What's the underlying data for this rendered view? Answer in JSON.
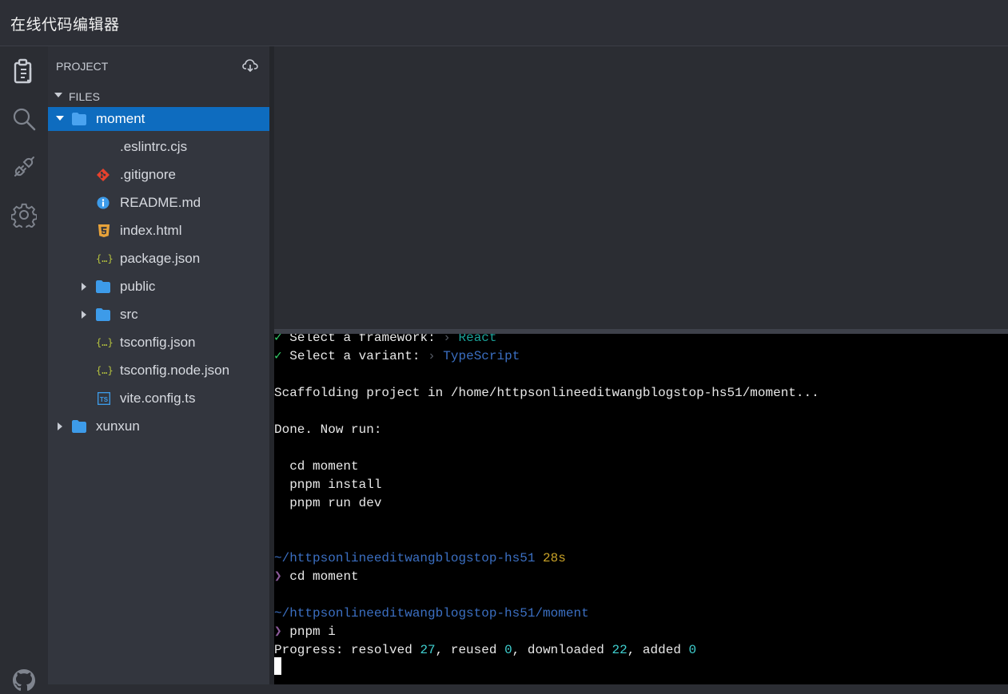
{
  "app": {
    "title": "在线代码编辑器"
  },
  "activity_bar": {
    "icons": [
      "explorer-icon",
      "search-icon",
      "plug-icon",
      "gear-icon",
      "github-icon"
    ]
  },
  "sidebar": {
    "header": "PROJECT",
    "header_icon": "cloud-download-icon",
    "section": "FILES",
    "tree": [
      {
        "name": "moment",
        "type": "folder",
        "expanded": true,
        "depth": 0,
        "selected": true
      },
      {
        "name": ".eslintrc.cjs",
        "type": "file",
        "icon": "none",
        "depth": 1
      },
      {
        "name": ".gitignore",
        "type": "file",
        "icon": "git-icon",
        "depth": 1
      },
      {
        "name": "README.md",
        "type": "file",
        "icon": "info-icon",
        "depth": 1
      },
      {
        "name": "index.html",
        "type": "file",
        "icon": "html5-icon",
        "depth": 1
      },
      {
        "name": "package.json",
        "type": "file",
        "icon": "json-icon",
        "depth": 1
      },
      {
        "name": "public",
        "type": "folder",
        "expanded": false,
        "depth": 1
      },
      {
        "name": "src",
        "type": "folder",
        "expanded": false,
        "depth": 1
      },
      {
        "name": "tsconfig.json",
        "type": "file",
        "icon": "json-icon",
        "depth": 1
      },
      {
        "name": "tsconfig.node.json",
        "type": "file",
        "icon": "json-icon",
        "depth": 1
      },
      {
        "name": "vite.config.ts",
        "type": "file",
        "icon": "typescript-icon",
        "depth": 1
      },
      {
        "name": "xunxun",
        "type": "folder",
        "expanded": false,
        "depth": 0
      }
    ]
  },
  "terminal": {
    "lines": [
      [
        {
          "t": "✓",
          "c": "green"
        },
        {
          "t": " Select a framework: "
        },
        {
          "t": "›",
          "c": "gray"
        },
        {
          "t": " React",
          "c": "teal"
        }
      ],
      [
        {
          "t": "✓",
          "c": "green"
        },
        {
          "t": " Select a variant: "
        },
        {
          "t": "›",
          "c": "gray"
        },
        {
          "t": " TypeScript",
          "c": "blue"
        }
      ],
      [],
      [
        {
          "t": "Scaffolding project in /home/httpsonlineeditwangblogstop-hs51/moment..."
        }
      ],
      [],
      [
        {
          "t": "Done. Now run:"
        }
      ],
      [],
      [
        {
          "t": "  cd moment"
        }
      ],
      [
        {
          "t": "  pnpm install"
        }
      ],
      [
        {
          "t": "  pnpm run dev"
        }
      ],
      [],
      [],
      [
        {
          "t": "~/httpsonlineeditwangblogstop-hs51",
          "c": "blue"
        },
        {
          "t": " 28s",
          "c": "yellow"
        }
      ],
      [
        {
          "t": "❯",
          "c": "purple"
        },
        {
          "t": " cd moment"
        }
      ],
      [],
      [
        {
          "t": "~/httpsonlineeditwangblogstop-hs51/moment",
          "c": "blue"
        }
      ],
      [
        {
          "t": "❯",
          "c": "purple"
        },
        {
          "t": " pnpm i"
        }
      ],
      [
        {
          "t": "Progress: resolved "
        },
        {
          "t": "27",
          "c": "cyan"
        },
        {
          "t": ", reused "
        },
        {
          "t": "0",
          "c": "cyan"
        },
        {
          "t": ", downloaded "
        },
        {
          "t": "22",
          "c": "cyan"
        },
        {
          "t": ", added "
        },
        {
          "t": "0",
          "c": "cyan"
        }
      ]
    ]
  },
  "colors": {
    "selection": "#0e6cbf",
    "folder": "#3d9be9",
    "terminal_bg": "#000000"
  }
}
